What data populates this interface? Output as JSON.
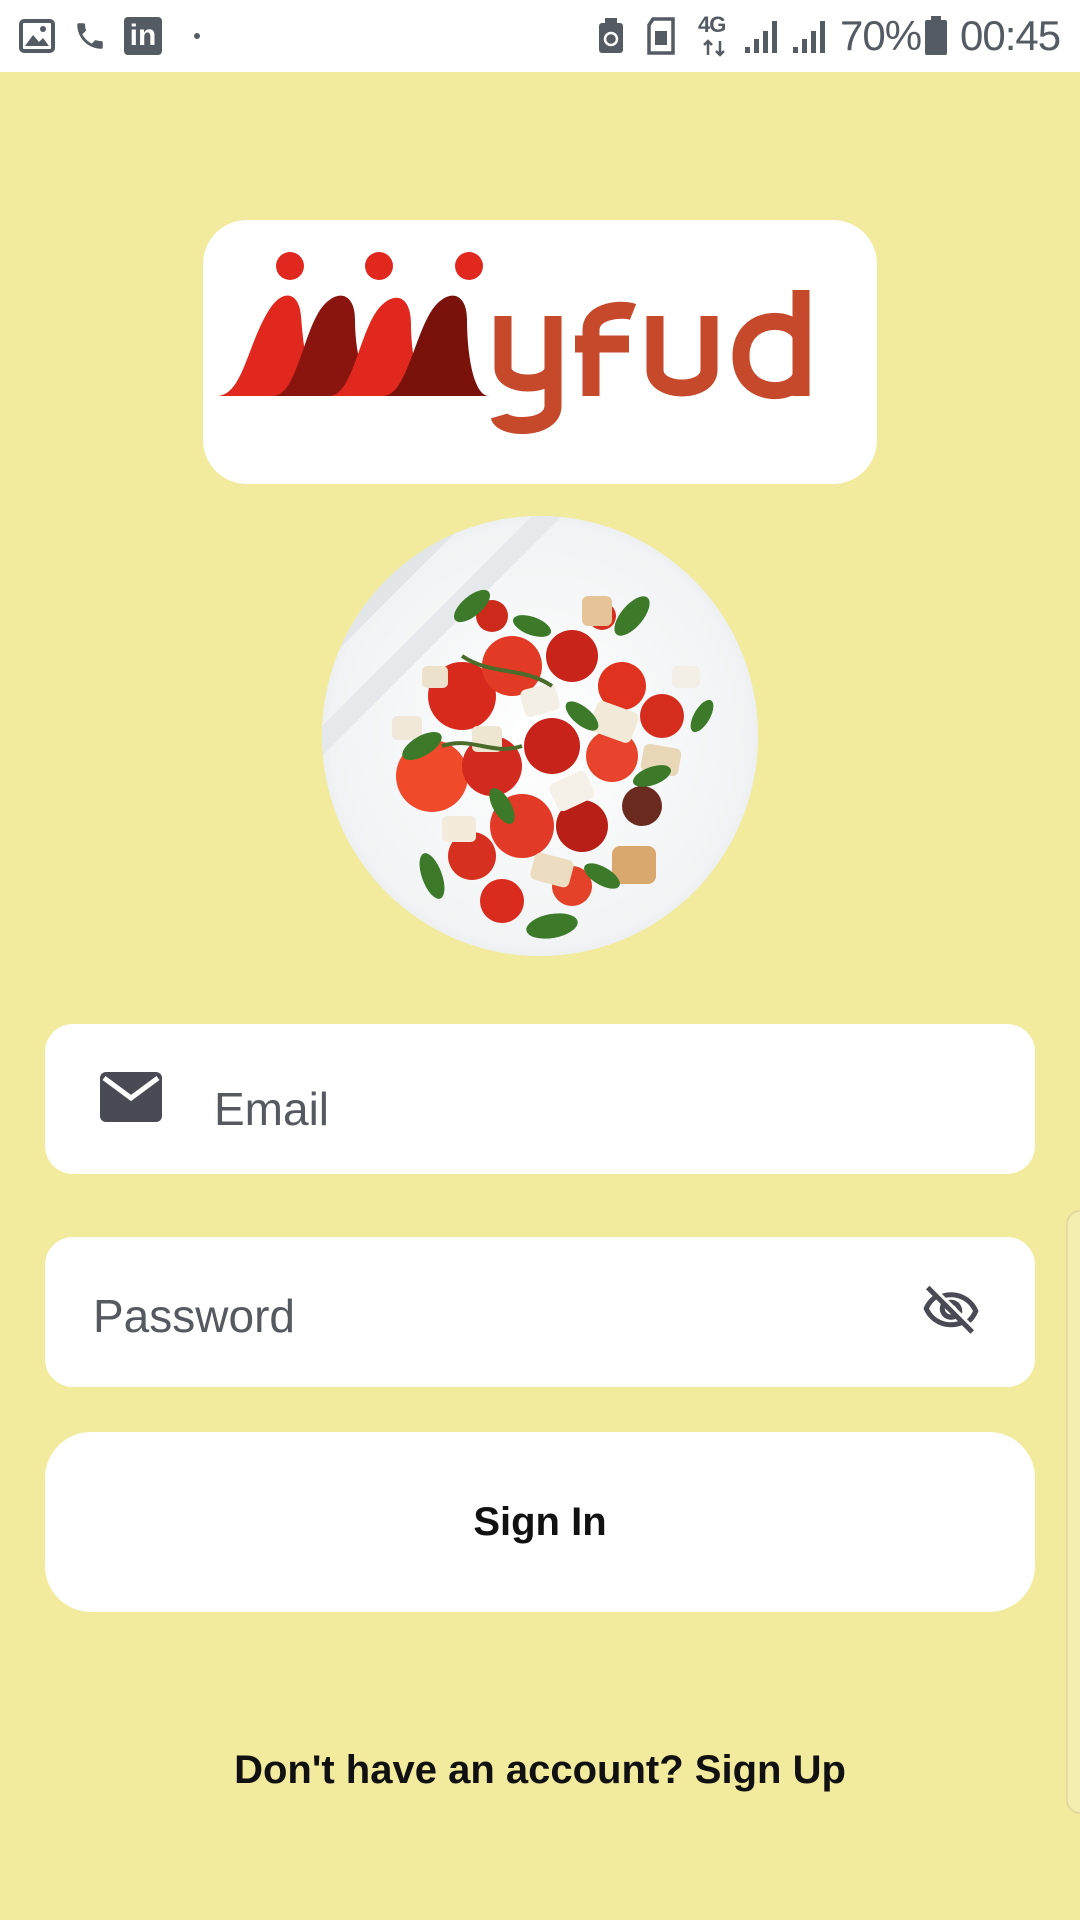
{
  "status_bar": {
    "battery_percent": "70%",
    "time": "00:45",
    "network_type": "4G",
    "left_icons": [
      "gallery-icon",
      "phone-icon",
      "linkedin-icon",
      "dot-icon"
    ],
    "right_icons": [
      "sim-recycle-icon",
      "sim-card-icon",
      "network-4g-icon",
      "signal-icon",
      "signal-icon",
      "battery-icon"
    ],
    "linkedin_glyph": "in"
  },
  "logo": {
    "text": "ʍyfud",
    "colors": {
      "primary_red": "#e0281e",
      "dark_red": "#7a120c",
      "brown_red": "#c6492c"
    }
  },
  "food_image": {
    "description_icon": "salad-photo"
  },
  "form": {
    "email": {
      "placeholder": "Email",
      "value": "",
      "icon": "mail-icon"
    },
    "password": {
      "placeholder": "Password",
      "value": "",
      "icon": "visibility-off-icon"
    },
    "submit_label": "Sign In"
  },
  "footer": {
    "prompt": "Don't have an account?",
    "link": "Sign Up"
  },
  "colors": {
    "background": "#f2eb9e",
    "card": "#ffffff",
    "text": "#111111",
    "icon": "#4a4a55"
  }
}
